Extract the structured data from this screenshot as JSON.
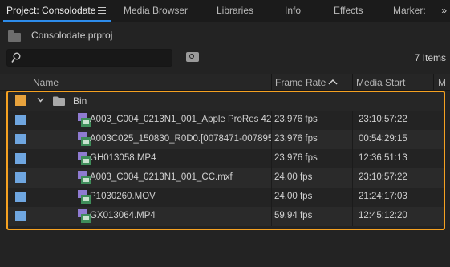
{
  "tabs": [
    {
      "label": "Project: Consolodate",
      "active": true
    },
    {
      "label": "Media Browser",
      "active": false
    },
    {
      "label": "Libraries",
      "active": false
    },
    {
      "label": "Info",
      "active": false
    },
    {
      "label": "Effects",
      "active": false
    },
    {
      "label": "Marker:",
      "active": false
    }
  ],
  "overflow_label": "»",
  "project": {
    "filename": "Consolodate.prproj"
  },
  "search": {
    "placeholder": "",
    "value": ""
  },
  "items_count": "7 Items",
  "columns": {
    "name": "Name",
    "frame_rate": "Frame Rate",
    "media_start": "Media Start",
    "extra": "M"
  },
  "bin": {
    "label": "Bin",
    "color": "#e8a33d"
  },
  "clip_label_color": "#6fa6e0",
  "clips": [
    {
      "name": "A003_C004_0213N1_001_Apple ProRes 42",
      "frame_rate": "23.976 fps",
      "media_start": "23:10:57:22"
    },
    {
      "name": "A003C025_150830_R0D0.[0078471-007895",
      "frame_rate": "23.976 fps",
      "media_start": "00:54:29:15"
    },
    {
      "name": "GH013058.MP4",
      "frame_rate": "23.976 fps",
      "media_start": "12:36:51:13"
    },
    {
      "name": "A003_C004_0213N1_001_CC.mxf",
      "frame_rate": "24.00 fps",
      "media_start": "23:10:57:22"
    },
    {
      "name": "P1030260.MOV",
      "frame_rate": "24.00 fps",
      "media_start": "21:24:17:03"
    },
    {
      "name": "GX013064.MP4",
      "frame_rate": "59.94 fps",
      "media_start": "12:45:12:20"
    }
  ],
  "highlight_color": "#f5a121"
}
